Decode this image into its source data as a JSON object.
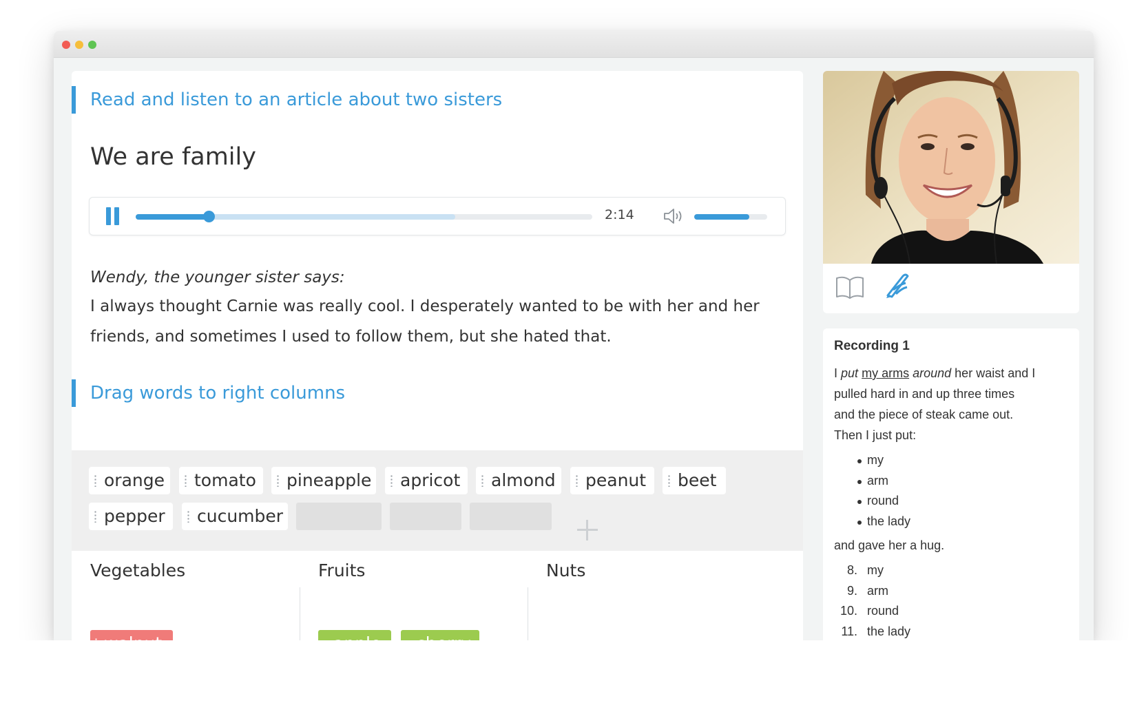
{
  "window": {
    "controls": [
      "close",
      "minimize",
      "maximize"
    ]
  },
  "lesson": {
    "section1_title": "Read and listen to an article about two sisters",
    "article_title": "We are family",
    "player": {
      "progress": 0.16,
      "buffered": 0.7,
      "time": "2:14",
      "volume": 0.75,
      "pause_icon": "pause-icon",
      "volume_icon": "volume-icon"
    },
    "speaker": "Wendy, the younger sister says:",
    "quote": "I always thought Carnie was really cool. I desperately wanted to be with her and her friends, and sometimes I used to follow them, but she hated that.",
    "section2_title": "Drag words to right columns",
    "word_bank": [
      "orange",
      "tomato",
      "pineapple",
      "apricot",
      "almond",
      "peanut",
      "beet",
      "pepper",
      "cucumber"
    ],
    "columns": [
      {
        "label": "Vegetables",
        "items": [
          "walnut"
        ]
      },
      {
        "label": "Fruits",
        "items": [
          "apple",
          "cherry"
        ]
      },
      {
        "label": "Nuts",
        "items": []
      }
    ]
  },
  "sidebar": {
    "tools": [
      "book-icon",
      "pen-icon"
    ],
    "recording": {
      "title": "Recording 1",
      "w1": "I",
      "w2": "put",
      "w3": "my arms",
      "w4": "around",
      "line1_rest": "her waist and I",
      "line2": "pulled hard in and up three times",
      "line3": "and the piece of steak came out.",
      "line4": "Then I just put:",
      "bullets": [
        "my",
        "arm",
        "round",
        "the lady"
      ],
      "after": "and gave her a hug.",
      "numbered": [
        {
          "num": "8.",
          "text": "my"
        },
        {
          "num": "9.",
          "text": "arm"
        },
        {
          "num": "10.",
          "text": "round"
        },
        {
          "num": "11.",
          "text": "the lady"
        }
      ]
    }
  },
  "colors": {
    "accent": "#3a9ad9",
    "wrong": "#f07b79",
    "correct": "#9ccb4f",
    "bank_bg": "#efefef"
  }
}
